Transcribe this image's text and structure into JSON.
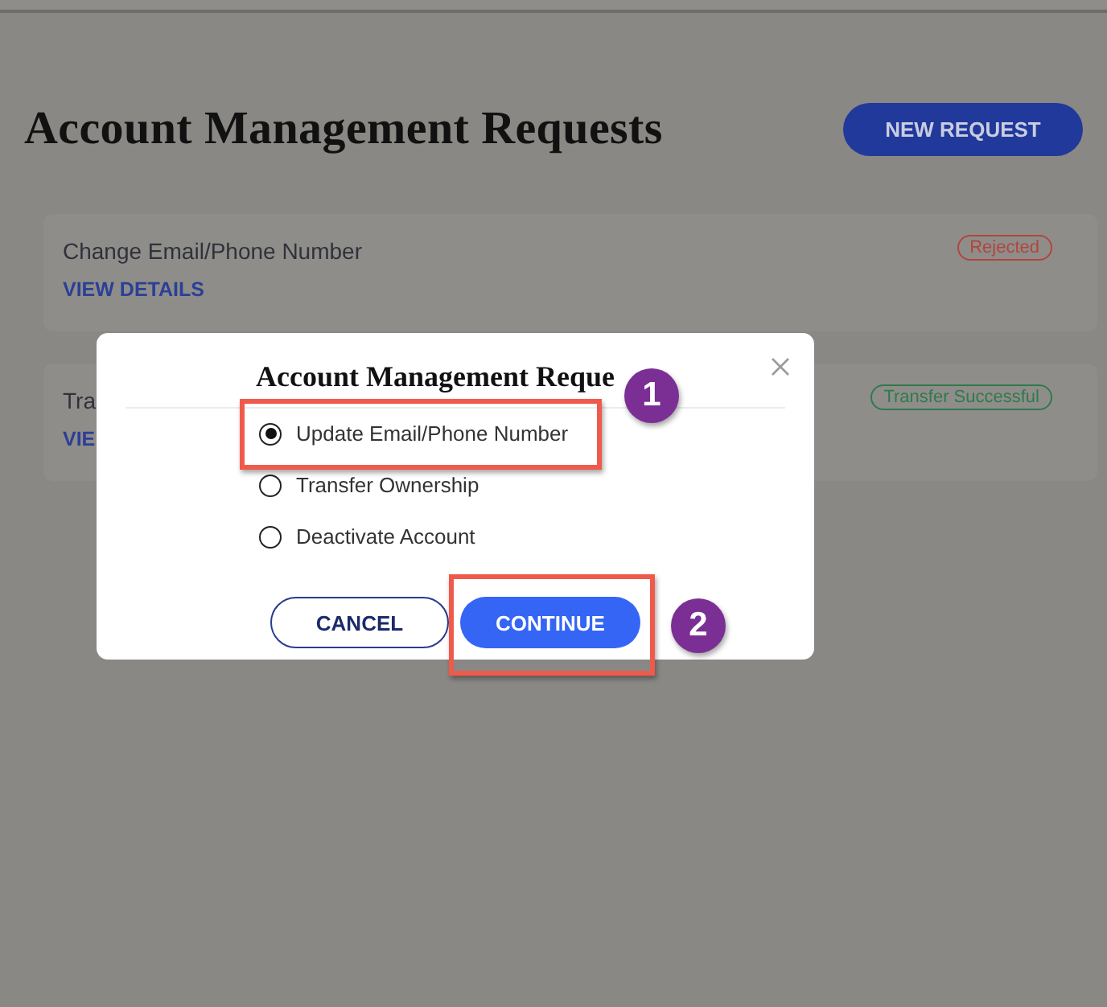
{
  "page": {
    "title": "Account Management Requests",
    "new_request_button": "NEW REQUEST"
  },
  "requests": [
    {
      "title": "Change Email/Phone Number",
      "link": "VIEW DETAILS",
      "status": "Rejected",
      "color": "#b0463d"
    },
    {
      "title": "Tra",
      "link": "VIE",
      "status": "Transfer Successful",
      "color": "#2f7a4c"
    }
  ],
  "modal": {
    "title": "Account Management Reque",
    "options": [
      {
        "label": "Update Email/Phone Number",
        "selected": true
      },
      {
        "label": "Transfer Ownership",
        "selected": false
      },
      {
        "label": "Deactivate Account",
        "selected": false
      }
    ],
    "cancel": "CANCEL",
    "continue": "CONTINUE"
  },
  "annotations": [
    {
      "number": "1"
    },
    {
      "number": "2"
    }
  ]
}
